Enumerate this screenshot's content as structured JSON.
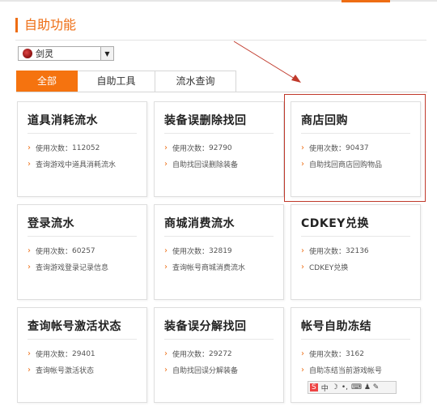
{
  "section": {
    "title": "自助功能"
  },
  "game_select": {
    "value": "剑灵"
  },
  "tabs": [
    {
      "label": "全部",
      "active": true
    },
    {
      "label": "自助工具",
      "active": false
    },
    {
      "label": "流水查询",
      "active": false
    }
  ],
  "usage_prefix": "使用次数：",
  "cards": [
    {
      "title": "道具消耗流水",
      "count": "112052",
      "desc": "查询游戏中道具消耗流水"
    },
    {
      "title": "装备误删除找回",
      "count": "92790",
      "desc": "自助找回误删除装备"
    },
    {
      "title": "商店回购",
      "count": "90437",
      "desc": "自助找回商店回购物品"
    },
    {
      "title": "登录流水",
      "count": "60257",
      "desc": "查询游戏登录记录信息"
    },
    {
      "title": "商城消费流水",
      "count": "32819",
      "desc": "查询帐号商城消费流水"
    },
    {
      "title": "CDKEY兑换",
      "count": "32136",
      "desc": "CDKEY兑换"
    },
    {
      "title": "查询帐号激活状态",
      "count": "29401",
      "desc": "查询帐号激活状态"
    },
    {
      "title": "装备误分解找回",
      "count": "29272",
      "desc": "自助找回误分解装备"
    },
    {
      "title": "帐号自助冻结",
      "count": "3162",
      "desc": "自助冻结当前游戏帐号"
    }
  ],
  "ime_bar": {
    "logo": "S",
    "mode": "中",
    "punct": "•,",
    "symbols": "⌨ ♟ ✎"
  },
  "colors": {
    "accent": "#ee6d13",
    "highlight": "#c0392b"
  }
}
